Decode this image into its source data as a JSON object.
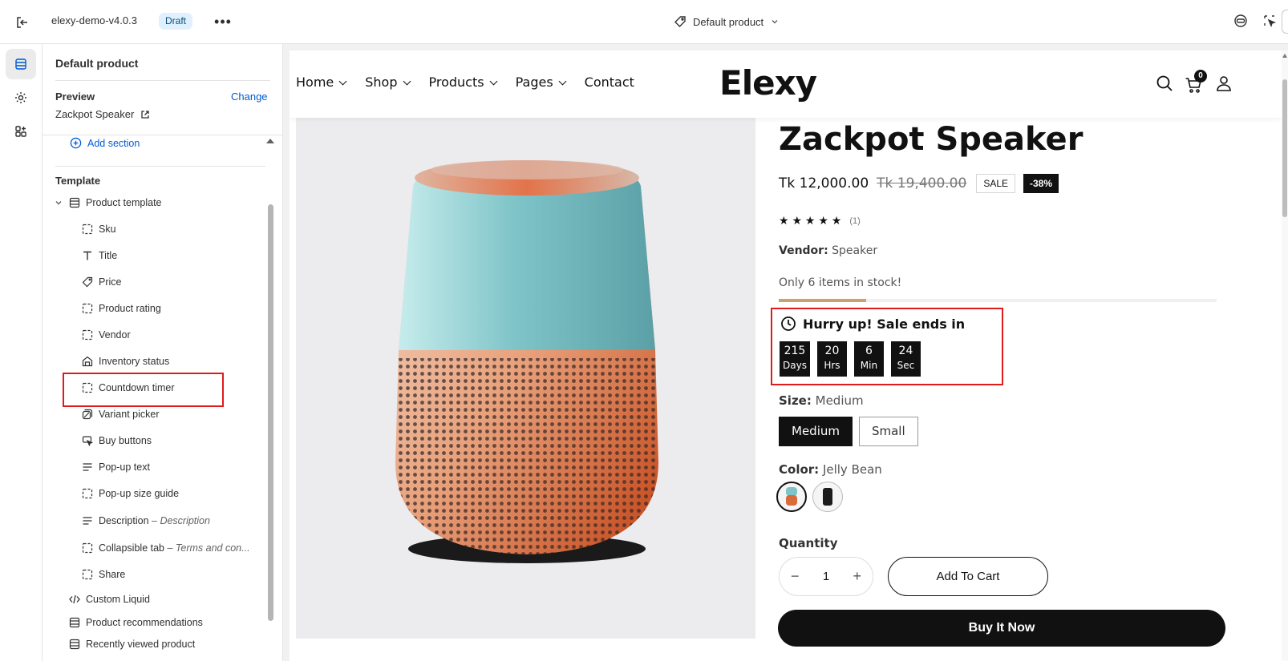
{
  "topbar": {
    "store_name": "elexy-demo-v4.0.3",
    "status_badge": "Draft",
    "template_name": "Default product"
  },
  "panel": {
    "title": "Default product",
    "preview_label": "Preview",
    "change_label": "Change",
    "preview_item": "Zackpot Speaker",
    "add_section": "Add section",
    "template_label": "Template",
    "tree": [
      {
        "label": "Product template",
        "icon": "template-icon"
      },
      {
        "label": "Sku",
        "icon": "block-icon"
      },
      {
        "label": "Title",
        "icon": "text-icon"
      },
      {
        "label": "Price",
        "icon": "price-tag-icon"
      },
      {
        "label": "Product rating",
        "icon": "block-icon"
      },
      {
        "label": "Vendor",
        "icon": "block-icon"
      },
      {
        "label": "Inventory status",
        "icon": "inventory-icon"
      },
      {
        "label": "Countdown timer",
        "icon": "block-icon"
      },
      {
        "label": "Variant picker",
        "icon": "variant-icon"
      },
      {
        "label": "Buy buttons",
        "icon": "cursor-click-icon"
      },
      {
        "label": "Pop-up text",
        "icon": "text-lines-icon"
      },
      {
        "label": "Pop-up size guide",
        "icon": "block-icon"
      },
      {
        "label": "Description",
        "sub": "– Description",
        "icon": "text-lines-icon"
      },
      {
        "label": "Collapsible tab",
        "sub": "– Terms and con...",
        "icon": "block-icon"
      },
      {
        "label": "Share",
        "icon": "block-icon"
      },
      {
        "label": "Custom Liquid",
        "icon": "code-icon"
      },
      {
        "label": "Product recommendations",
        "icon": "template-icon"
      },
      {
        "label": "Recently viewed product",
        "icon": "template-icon"
      }
    ]
  },
  "site": {
    "nav": [
      "Home",
      "Shop",
      "Products",
      "Pages",
      "Contact"
    ],
    "logo": "Elexy",
    "cart_count": "0"
  },
  "product": {
    "title": "Zackpot Speaker",
    "price": "Tk 12,000.00",
    "compare_price": "Tk 19,400.00",
    "sale_badge": "SALE",
    "discount_badge": "-38%",
    "rating": 5,
    "stars": "★ ★ ★ ★ ★",
    "rating_count": "(1)",
    "vendor_label": "Vendor:",
    "vendor": "Speaker",
    "stock_text": "Only 6 items in stock!",
    "stock_fraction": 0.2,
    "countdown_heading": "Hurry up! Sale ends in",
    "countdown": [
      {
        "value": "215",
        "unit": "Days"
      },
      {
        "value": "20",
        "unit": "Hrs"
      },
      {
        "value": "6",
        "unit": "Min"
      },
      {
        "value": "24",
        "unit": "Sec"
      }
    ],
    "size_label": "Size:",
    "size_value": "Medium",
    "sizes": [
      "Medium",
      "Small"
    ],
    "color_label": "Color:",
    "color_value": "Jelly Bean",
    "quantity_label": "Quantity",
    "quantity": "1",
    "add_to_cart": "Add To Cart",
    "buy_now": "Buy It Now"
  },
  "colors": {
    "accent_blue": "#005bd3",
    "highlight_red": "#e01b1b",
    "dark": "#111111"
  }
}
